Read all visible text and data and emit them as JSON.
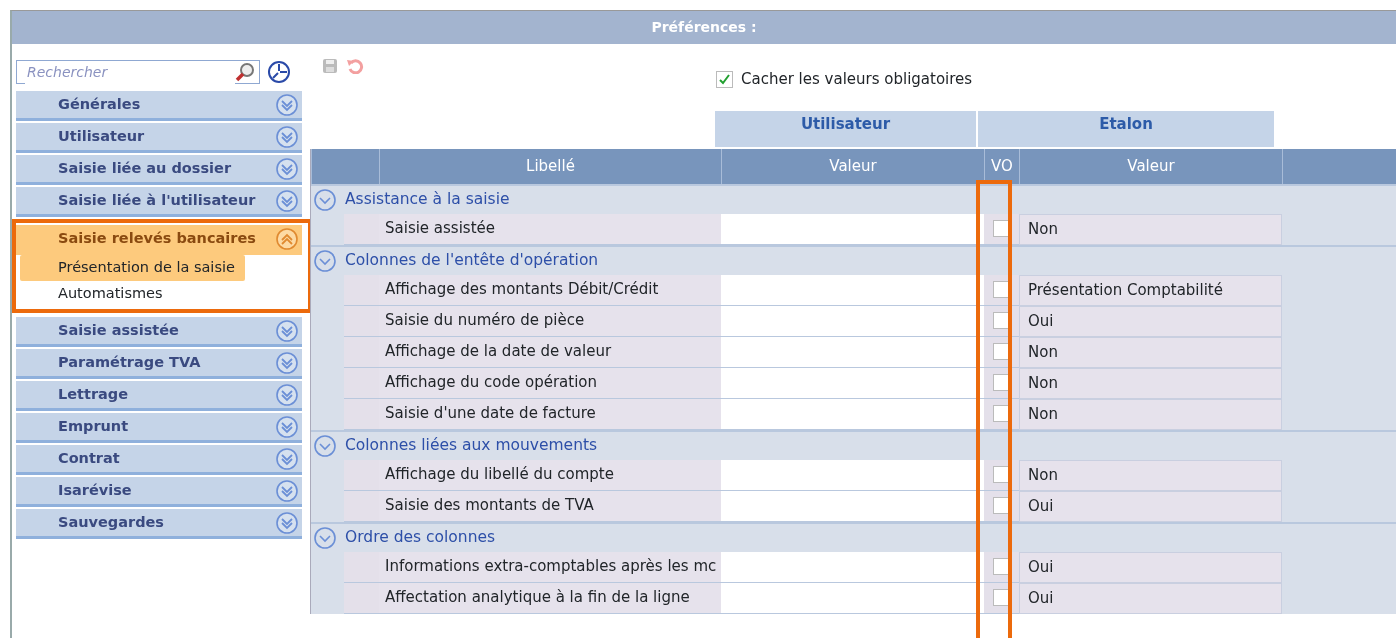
{
  "window": {
    "title": "Préférences :"
  },
  "sidebar": {
    "search": {
      "placeholder": "Rechercher"
    },
    "items": [
      {
        "label": "Générales",
        "expanded": false,
        "highlighted": false
      },
      {
        "label": "Utilisateur",
        "expanded": false,
        "highlighted": false
      },
      {
        "label": "Saisie liée au dossier",
        "expanded": false,
        "highlighted": false
      },
      {
        "label": "Saisie liée à l'utilisateur",
        "expanded": false,
        "highlighted": false
      },
      {
        "label": "Saisie relevés bancaires",
        "expanded": true,
        "highlighted": true,
        "children": [
          {
            "label": "Présentation de la saisie",
            "selected": true
          },
          {
            "label": "Automatismes",
            "selected": false
          }
        ]
      },
      {
        "label": "Saisie assistée",
        "expanded": false,
        "highlighted": false
      },
      {
        "label": "Paramétrage TVA",
        "expanded": false,
        "highlighted": false
      },
      {
        "label": "Lettrage",
        "expanded": false,
        "highlighted": false
      },
      {
        "label": "Emprunt",
        "expanded": false,
        "highlighted": false
      },
      {
        "label": "Contrat",
        "expanded": false,
        "highlighted": false
      },
      {
        "label": "Isarévise",
        "expanded": false,
        "highlighted": false
      },
      {
        "label": "Sauvegardes",
        "expanded": false,
        "highlighted": false
      }
    ]
  },
  "options": {
    "hide_mandatory": {
      "label": "Cacher les valeurs obligatoires",
      "checked": true
    }
  },
  "table": {
    "groups": [
      "Utilisateur",
      "Etalon"
    ],
    "columns": [
      "Libellé",
      "Valeur",
      "VO",
      "Valeur"
    ],
    "vo_highlighted": true,
    "sections": [
      {
        "title": "Assistance à la saisie",
        "expanded": true,
        "rows": [
          {
            "label": "Saisie assistée",
            "vo": false,
            "reference_value": "Non"
          }
        ]
      },
      {
        "title": "Colonnes de l'entête d'opération",
        "expanded": true,
        "rows": [
          {
            "label": "Affichage des montants Débit/Crédit",
            "vo": false,
            "reference_value": "Présentation Comptabilité"
          },
          {
            "label": "Saisie du numéro de pièce",
            "vo": false,
            "reference_value": "Oui"
          },
          {
            "label": "Affichage de la date de valeur",
            "vo": false,
            "reference_value": "Non"
          },
          {
            "label": "Affichage du code opération",
            "vo": false,
            "reference_value": "Non"
          },
          {
            "label": "Saisie d'une date de facture",
            "vo": false,
            "reference_value": "Non"
          }
        ]
      },
      {
        "title": "Colonnes liées aux mouvements",
        "expanded": true,
        "rows": [
          {
            "label": "Affichage du libellé du compte",
            "vo": false,
            "reference_value": "Non"
          },
          {
            "label": "Saisie des montants de TVA",
            "vo": false,
            "reference_value": "Oui"
          }
        ]
      },
      {
        "title": "Ordre des colonnes",
        "expanded": true,
        "rows": [
          {
            "label": "Informations extra-comptables après les mc",
            "vo": false,
            "reference_value": "Oui"
          },
          {
            "label": "Affectation analytique à la fin de la ligne",
            "vo": false,
            "reference_value": "Oui"
          }
        ]
      }
    ]
  }
}
